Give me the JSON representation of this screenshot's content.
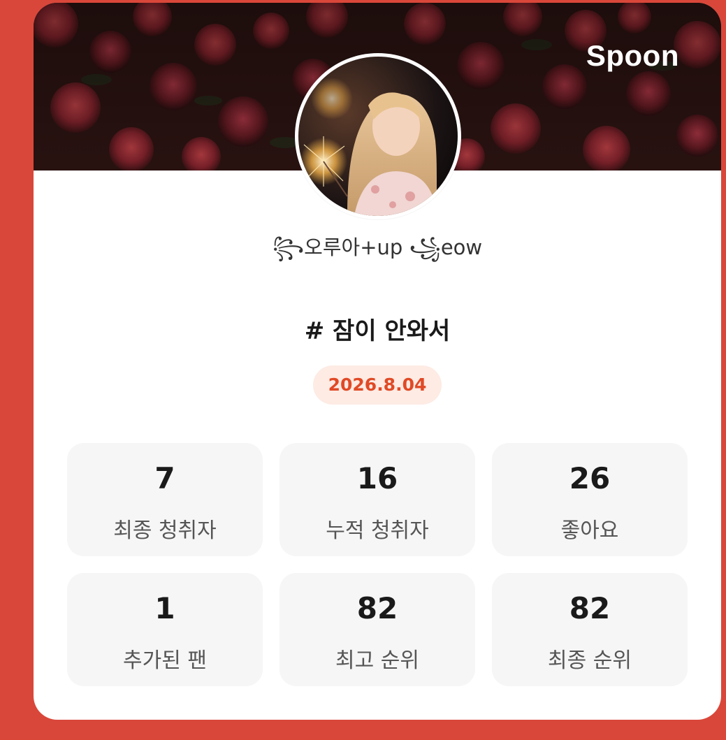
{
  "brand": "Spoon",
  "profile": {
    "nickname": "꧂오루아+up ꧁eow"
  },
  "broadcast": {
    "title": "# 잠이 안와서",
    "date": "2026.8.04"
  },
  "stats": [
    {
      "value": "7",
      "label": "최종 청취자"
    },
    {
      "value": "16",
      "label": "누적 청취자"
    },
    {
      "value": "26",
      "label": "좋아요"
    },
    {
      "value": "1",
      "label": "추가된 팬"
    },
    {
      "value": "82",
      "label": "최고 순위"
    },
    {
      "value": "82",
      "label": "최종 순위"
    }
  ],
  "colors": {
    "background": "#d9473a",
    "accent": "#e04a26",
    "badge_bg": "#fdebe4",
    "card": "#ffffff",
    "tile": "#f6f6f6"
  }
}
